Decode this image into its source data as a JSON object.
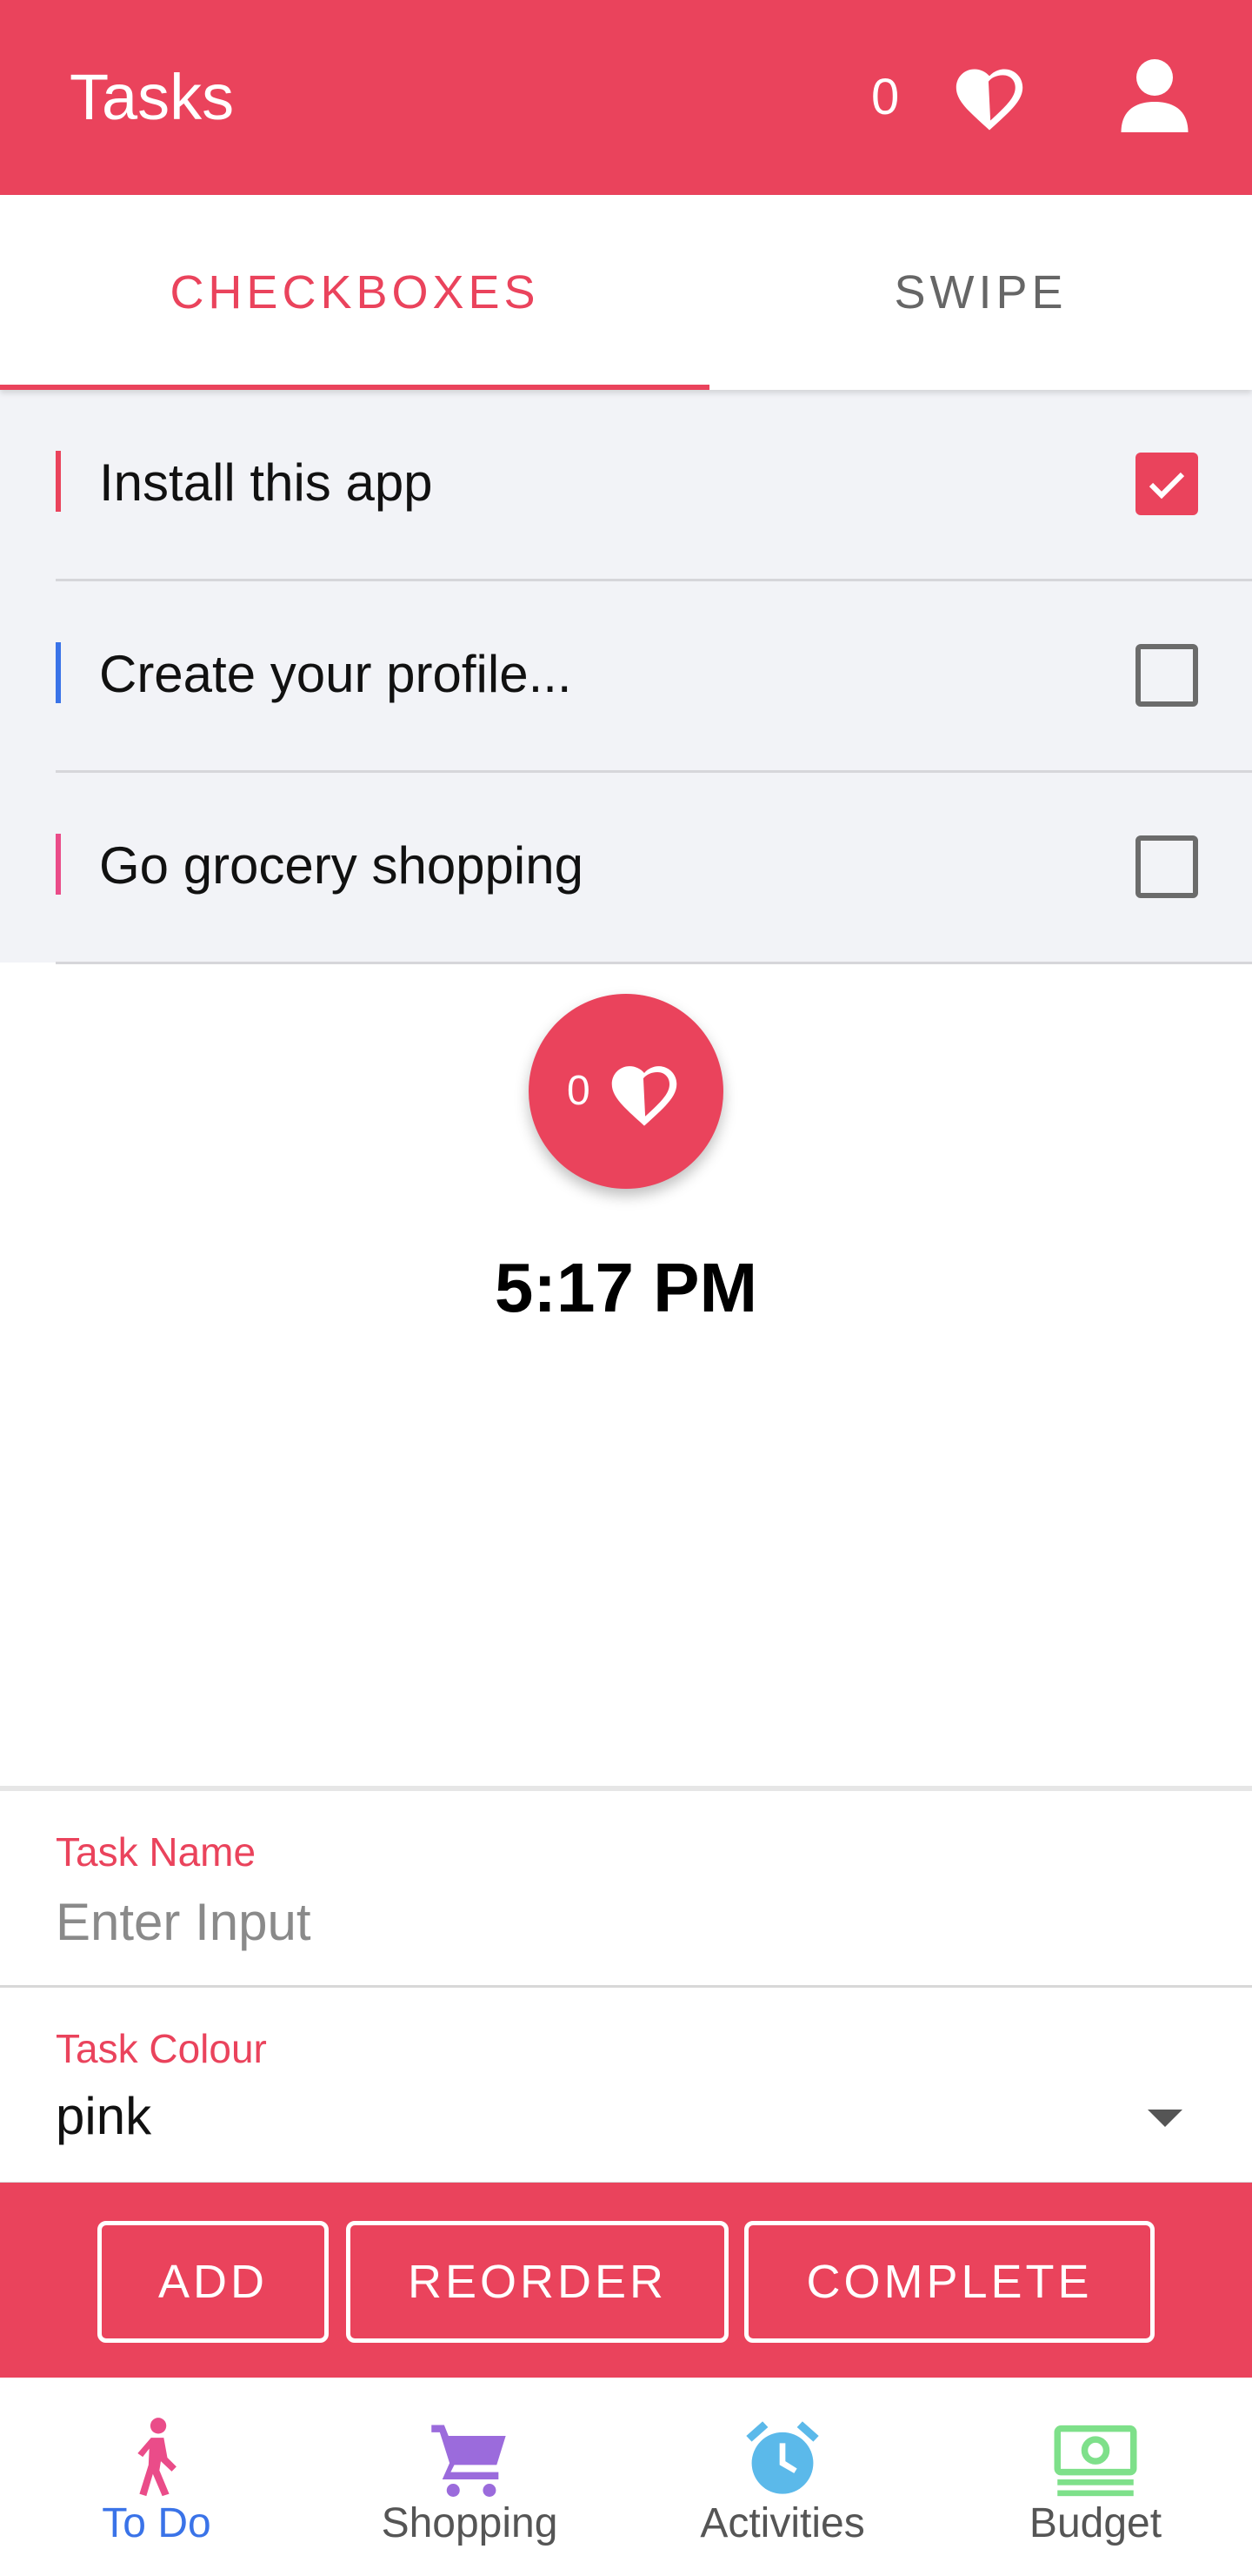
{
  "appbar": {
    "title": "Tasks",
    "like_count": "0"
  },
  "tabs": [
    {
      "label": "CHECKBOXES",
      "active": true
    },
    {
      "label": "SWIPE",
      "active": false
    }
  ],
  "tasks": [
    {
      "label": "Install this app",
      "checked": true,
      "color": "#ea435c"
    },
    {
      "label": "Create your profile...",
      "checked": false,
      "color": "#3a73e8"
    },
    {
      "label": "Go grocery shopping",
      "checked": false,
      "color": "#ea4c89"
    }
  ],
  "fab": {
    "count": "0"
  },
  "clock": "5:17 PM",
  "form": {
    "task_name": {
      "label": "Task Name",
      "placeholder": "Enter Input",
      "value": ""
    },
    "task_colour": {
      "label": "Task Colour",
      "value": "pink"
    }
  },
  "actions": {
    "add": "ADD",
    "reorder": "REORDER",
    "complete": "COMPLETE"
  },
  "bottom_nav": [
    {
      "label": "To Do",
      "icon": "walking-person-icon",
      "active": true
    },
    {
      "label": "Shopping",
      "icon": "shopping-cart-icon",
      "active": false
    },
    {
      "label": "Activities",
      "icon": "alarm-clock-icon",
      "active": false
    },
    {
      "label": "Budget",
      "icon": "money-icon",
      "active": false
    }
  ],
  "colors": {
    "accent": "#ea435c",
    "active_nav": "#3a73e8",
    "list_bg": "#f2f3f7"
  }
}
